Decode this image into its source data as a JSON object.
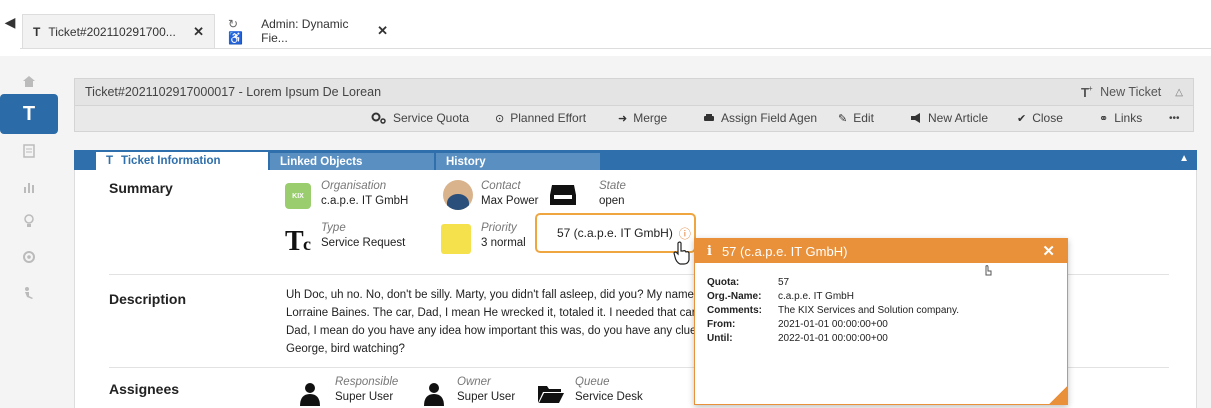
{
  "tabs": [
    {
      "icon": "T",
      "label": "Ticket#202110291700...",
      "close": "✕"
    },
    {
      "icon": "↻ ♿",
      "label": "Admin: Dynamic Fie...",
      "close": "✕"
    }
  ],
  "nav": [
    {
      "icon": "home-icon"
    },
    {
      "icon": "ticket-icon",
      "label": "T"
    },
    {
      "icon": "list-icon"
    },
    {
      "icon": "chart-icon"
    },
    {
      "icon": "bulb-icon"
    },
    {
      "icon": "settings-icon"
    },
    {
      "icon": "admin-icon"
    }
  ],
  "header": {
    "title": "Ticket#2021102917000017 - Lorem Ipsum De Lorean",
    "new_ticket": "New Ticket"
  },
  "toolbar": {
    "service_quota": "Service Quota",
    "planned_effort": "Planned Effort",
    "merge": "Merge",
    "assign": "Assign Field Agen",
    "edit": "Edit",
    "new_article": "New Article",
    "close": "Close",
    "links": "Links",
    "more": "•••"
  },
  "section_tabs": [
    "Ticket Information",
    "Linked Objects",
    "History"
  ],
  "summary": {
    "label": "Summary",
    "organisation_label": "Organisation",
    "organisation": "c.a.p.e. IT GmbH",
    "kix_logo": "KIX",
    "contact_label": "Contact",
    "contact": "Max Power",
    "state_label": "State",
    "state": "open",
    "type_label": "Type",
    "type": "Service Request",
    "priority_label": "Priority",
    "priority": "3 normal",
    "quota": "57 (c.a.p.e. IT GmbH)"
  },
  "description": {
    "label": "Description",
    "line1": "Uh Doc, uh no. No, don't be silly. Marty, you didn't fall asleep, did you? My name",
    "line2": "Lorraine Baines. The car, Dad, I mean He wrecked it, totaled it. I needed that car t",
    "line3": "Dad, I mean do you have any idea how important this was, do you have any clue?",
    "line4": "George, bird watching?"
  },
  "assignees": {
    "label": "Assignees",
    "responsible_label": "Responsible",
    "responsible": "Super User",
    "owner_label": "Owner",
    "owner": "Super User",
    "queue_label": "Queue",
    "queue": "Service Desk"
  },
  "popup": {
    "title": "57 (c.a.p.e. IT GmbH)",
    "close": "✕",
    "rows": [
      {
        "key": "Quota:",
        "value": "57"
      },
      {
        "key": "Org.-Name:",
        "value": "c.a.p.e. IT GmbH"
      },
      {
        "key": "Comments:",
        "value": "The KIX Services and Solution company."
      },
      {
        "key": "From:",
        "value": "2021-01-01 00:00:00+00"
      },
      {
        "key": "Until:",
        "value": "2022-01-01 00:00:00+00"
      }
    ]
  },
  "colors": {
    "accent": "#2f6fab",
    "popup": "#e8903a",
    "kix": "#9acd6e"
  }
}
